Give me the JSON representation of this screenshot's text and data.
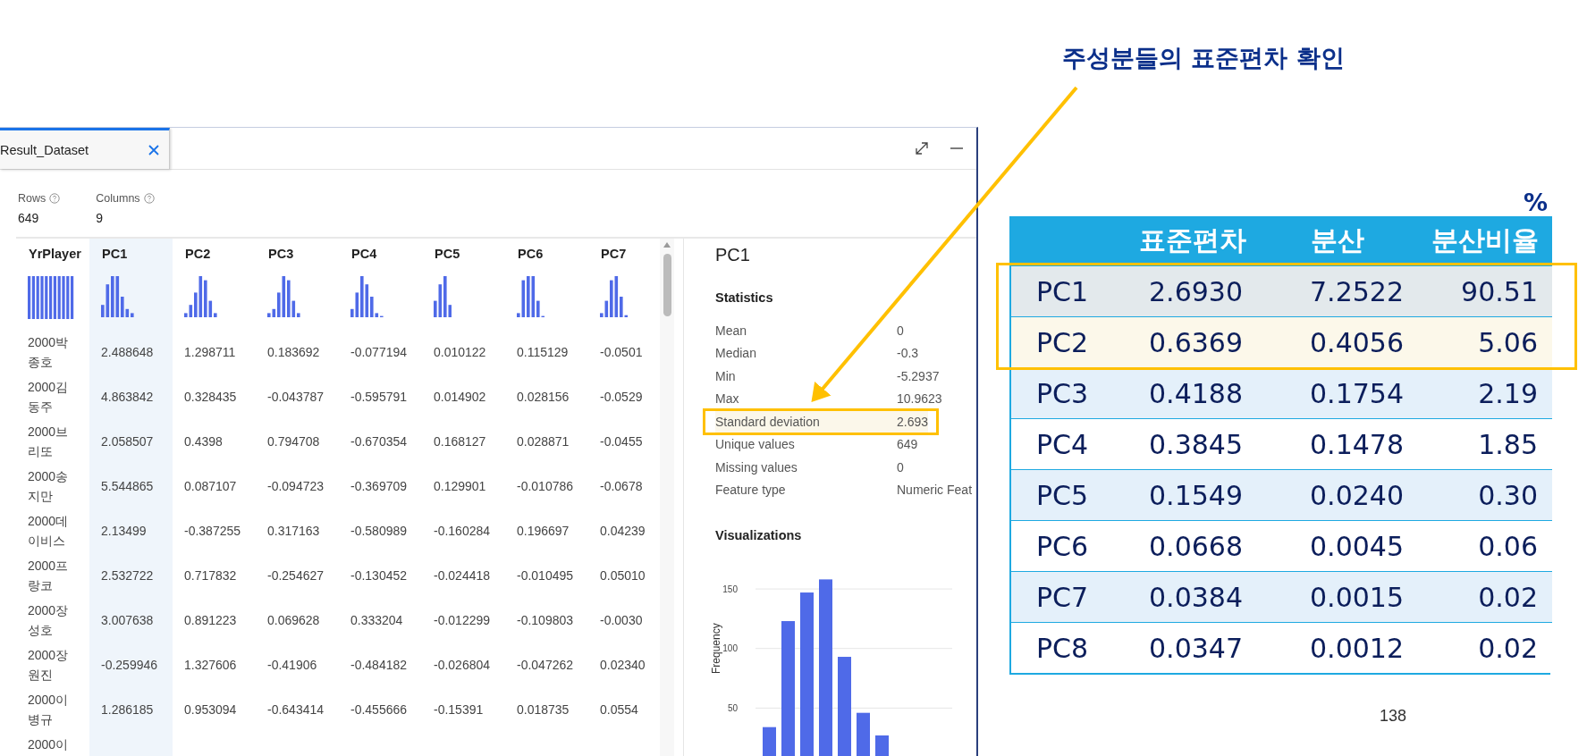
{
  "slide": {
    "title": "주성분들의 표준편차 확인",
    "page_number": "138"
  },
  "window": {
    "tabs": [
      {
        "label": "Result_Dataset",
        "selected": true
      }
    ],
    "summary": [
      {
        "label": "Rows",
        "value": "649"
      },
      {
        "label": "Columns",
        "value": "9"
      }
    ],
    "table": {
      "columns": [
        {
          "label": "YrPlayer",
          "selected": false
        },
        {
          "label": "PC1",
          "selected": true
        },
        {
          "label": "PC2",
          "selected": false
        },
        {
          "label": "PC3",
          "selected": false
        },
        {
          "label": "PC4",
          "selected": false
        },
        {
          "label": "PC5",
          "selected": false
        },
        {
          "label": "PC6",
          "selected": false
        },
        {
          "label": "PC7",
          "selected": false
        }
      ],
      "rows": [
        [
          "2000박종호",
          "2.488648",
          "1.298711",
          "0.183692",
          "-0.077194",
          "0.010122",
          "0.115129",
          "-0.0501"
        ],
        [
          "2000김동주",
          "4.863842",
          "0.328435",
          "-0.043787",
          "-0.595791",
          "0.014902",
          "0.028156",
          "-0.0529"
        ],
        [
          "2000브리또",
          "2.058507",
          "0.4398",
          "0.794708",
          "-0.670354",
          "0.168127",
          "0.028871",
          "-0.0455"
        ],
        [
          "2000송지만",
          "5.544865",
          "0.087107",
          "-0.094723",
          "-0.369709",
          "0.129901",
          "-0.010786",
          "-0.0678"
        ],
        [
          "2000데이비스",
          "2.13499",
          "-0.387255",
          "0.317163",
          "-0.580989",
          "-0.160284",
          "0.196697",
          "0.04239"
        ],
        [
          "2000프랑코",
          "2.532722",
          "0.717832",
          "-0.254627",
          "-0.130452",
          "-0.024418",
          "-0.010495",
          "0.05010"
        ],
        [
          "2000장성호",
          "3.007638",
          "0.891223",
          "0.069628",
          "0.333204",
          "-0.012299",
          "-0.109803",
          "-0.0030"
        ],
        [
          "2000장원진",
          "-0.259946",
          "1.327606",
          "-0.41906",
          "-0.484182",
          "-0.026804",
          "-0.047262",
          "0.02340"
        ],
        [
          "2000이병규",
          "1.286185",
          "0.953094",
          "-0.643414",
          "-0.455666",
          "-0.15391",
          "0.018735",
          "0.0554"
        ],
        [
          "2000이"
        ]
      ]
    },
    "details": {
      "title": "PC1",
      "statistics_heading": "Statistics",
      "stats": [
        {
          "label": "Mean",
          "value": "0",
          "highlighted": false
        },
        {
          "label": "Median",
          "value": "-0.3",
          "highlighted": false
        },
        {
          "label": "Min",
          "value": "-5.2937",
          "highlighted": false
        },
        {
          "label": "Max",
          "value": "10.9623",
          "highlighted": false
        },
        {
          "label": "Standard deviation",
          "value": "2.693",
          "highlighted": true
        },
        {
          "label": "Unique values",
          "value": "649",
          "highlighted": false
        },
        {
          "label": "Missing values",
          "value": "0",
          "highlighted": false
        },
        {
          "label": "Feature type",
          "value": "Numeric Feat",
          "highlighted": false
        }
      ],
      "visualizations_heading": "Visualizations",
      "histogram": {
        "ylabel": "Frequency",
        "tick_labels": [
          "150",
          "100",
          "50"
        ]
      }
    }
  },
  "summary_table": {
    "unit": "%",
    "columns": [
      "표준편차",
      "분산",
      "분산비율"
    ],
    "rows": [
      {
        "label": "PC1",
        "values": [
          "2.6930",
          "7.2522",
          "90.51"
        ],
        "highlighted": true
      },
      {
        "label": "PC2",
        "values": [
          "0.6369",
          "0.4056",
          "5.06"
        ],
        "highlighted": true
      },
      {
        "label": "PC3",
        "values": [
          "0.4188",
          "0.1754",
          "2.19"
        ],
        "highlighted": false
      },
      {
        "label": "PC4",
        "values": [
          "0.3845",
          "0.1478",
          "1.85"
        ],
        "highlighted": false
      },
      {
        "label": "PC5",
        "values": [
          "0.1549",
          "0.0240",
          "0.30"
        ],
        "highlighted": false
      },
      {
        "label": "PC6",
        "values": [
          "0.0668",
          "0.0045",
          "0.06"
        ],
        "highlighted": false
      },
      {
        "label": "PC7",
        "values": [
          "0.0384",
          "0.0015",
          "0.02"
        ],
        "highlighted": false
      },
      {
        "label": "PC8",
        "values": [
          "0.0347",
          "0.0012",
          "0.02"
        ],
        "highlighted": false
      }
    ]
  }
}
